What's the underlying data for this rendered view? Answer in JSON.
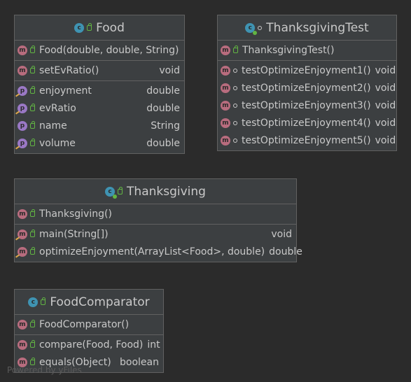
{
  "classes": [
    {
      "id": "food",
      "name": "Food",
      "constructors": [
        {
          "name": "Food(double, double, String)",
          "type": ""
        }
      ],
      "methods": [
        {
          "name": "setEvRatio()",
          "type": "void"
        }
      ],
      "fields": [
        {
          "name": "enjoyment",
          "type": "double"
        },
        {
          "name": "evRatio",
          "type": "double"
        },
        {
          "name": "name",
          "type": "String"
        },
        {
          "name": "volume",
          "type": "double"
        }
      ]
    },
    {
      "id": "thanksgiving-test",
      "name": "ThanksgivingTest",
      "constructors": [
        {
          "name": "ThanksgivingTest()",
          "type": ""
        }
      ],
      "methods": [
        {
          "name": "testOptimizeEnjoyment1()",
          "type": "void"
        },
        {
          "name": "testOptimizeEnjoyment2()",
          "type": "void"
        },
        {
          "name": "testOptimizeEnjoyment3()",
          "type": "void"
        },
        {
          "name": "testOptimizeEnjoyment4()",
          "type": "void"
        },
        {
          "name": "testOptimizeEnjoyment5()",
          "type": "void"
        }
      ]
    },
    {
      "id": "thanksgiving",
      "name": "Thanksgiving",
      "constructors": [
        {
          "name": "Thanksgiving()",
          "type": ""
        }
      ],
      "methods": [
        {
          "name": "main(String[])",
          "type": "void"
        },
        {
          "name": "optimizeEnjoyment(ArrayList<Food>, double)",
          "type": "double"
        }
      ]
    },
    {
      "id": "food-comparator",
      "name": "FoodComparator",
      "constructors": [
        {
          "name": "FoodComparator()",
          "type": ""
        }
      ],
      "methods": [
        {
          "name": "compare(Food, Food)",
          "type": "int"
        },
        {
          "name": "equals(Object)",
          "type": "boolean"
        }
      ]
    }
  ],
  "icons": {
    "class": "class-icon",
    "method": "method-icon",
    "field": "field-icon",
    "public": "lock-icon",
    "package": "package-private-icon"
  },
  "colors": {
    "background": "#2b2b2b",
    "panel": "#3c3f41",
    "method": "#b86c7e",
    "field": "#9a78c5",
    "class": "#3f93b2",
    "public": "#62b543"
  },
  "watermark": "Powered by yFiles"
}
